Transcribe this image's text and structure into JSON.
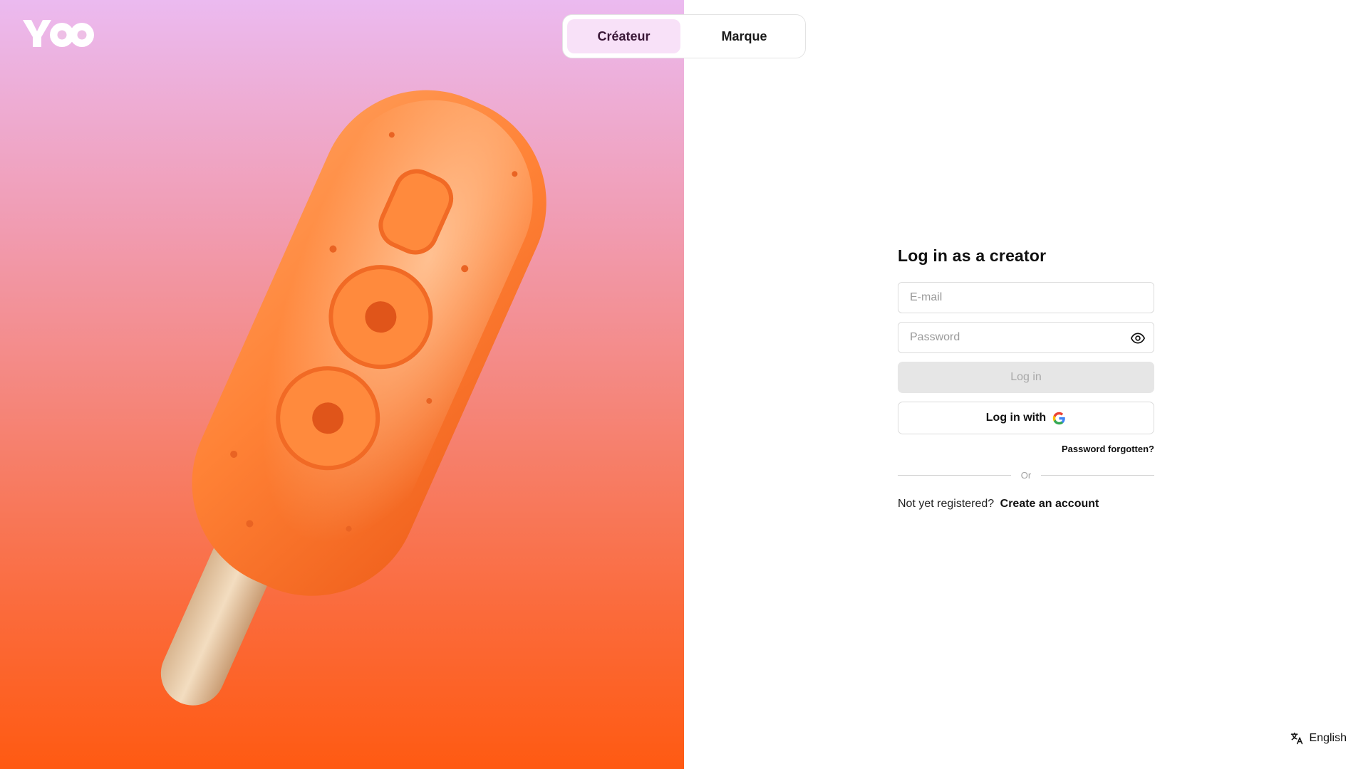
{
  "brand": {
    "logo_text": "YOO"
  },
  "role_switch": {
    "tabs": [
      {
        "label": "Créateur",
        "active": true
      },
      {
        "label": "Marque",
        "active": false
      }
    ]
  },
  "login": {
    "title": "Log in as a creator",
    "email_placeholder": "E-mail",
    "password_placeholder": "Password",
    "login_button": "Log in",
    "google_button": "Log in with",
    "forgot_password": "Password forgotten?",
    "divider": "Or",
    "register_prompt": "Not yet registered?",
    "register_link": "Create an account"
  },
  "language": {
    "label": "English",
    "icon": "translate-icon"
  },
  "colors": {
    "accent_tab_bg": "#f8e1f8",
    "popsicle_orange": "#ff7a2a",
    "disabled_button": "#e6e6e6"
  },
  "icons": [
    "eye-icon",
    "google-icon",
    "translate-icon"
  ]
}
